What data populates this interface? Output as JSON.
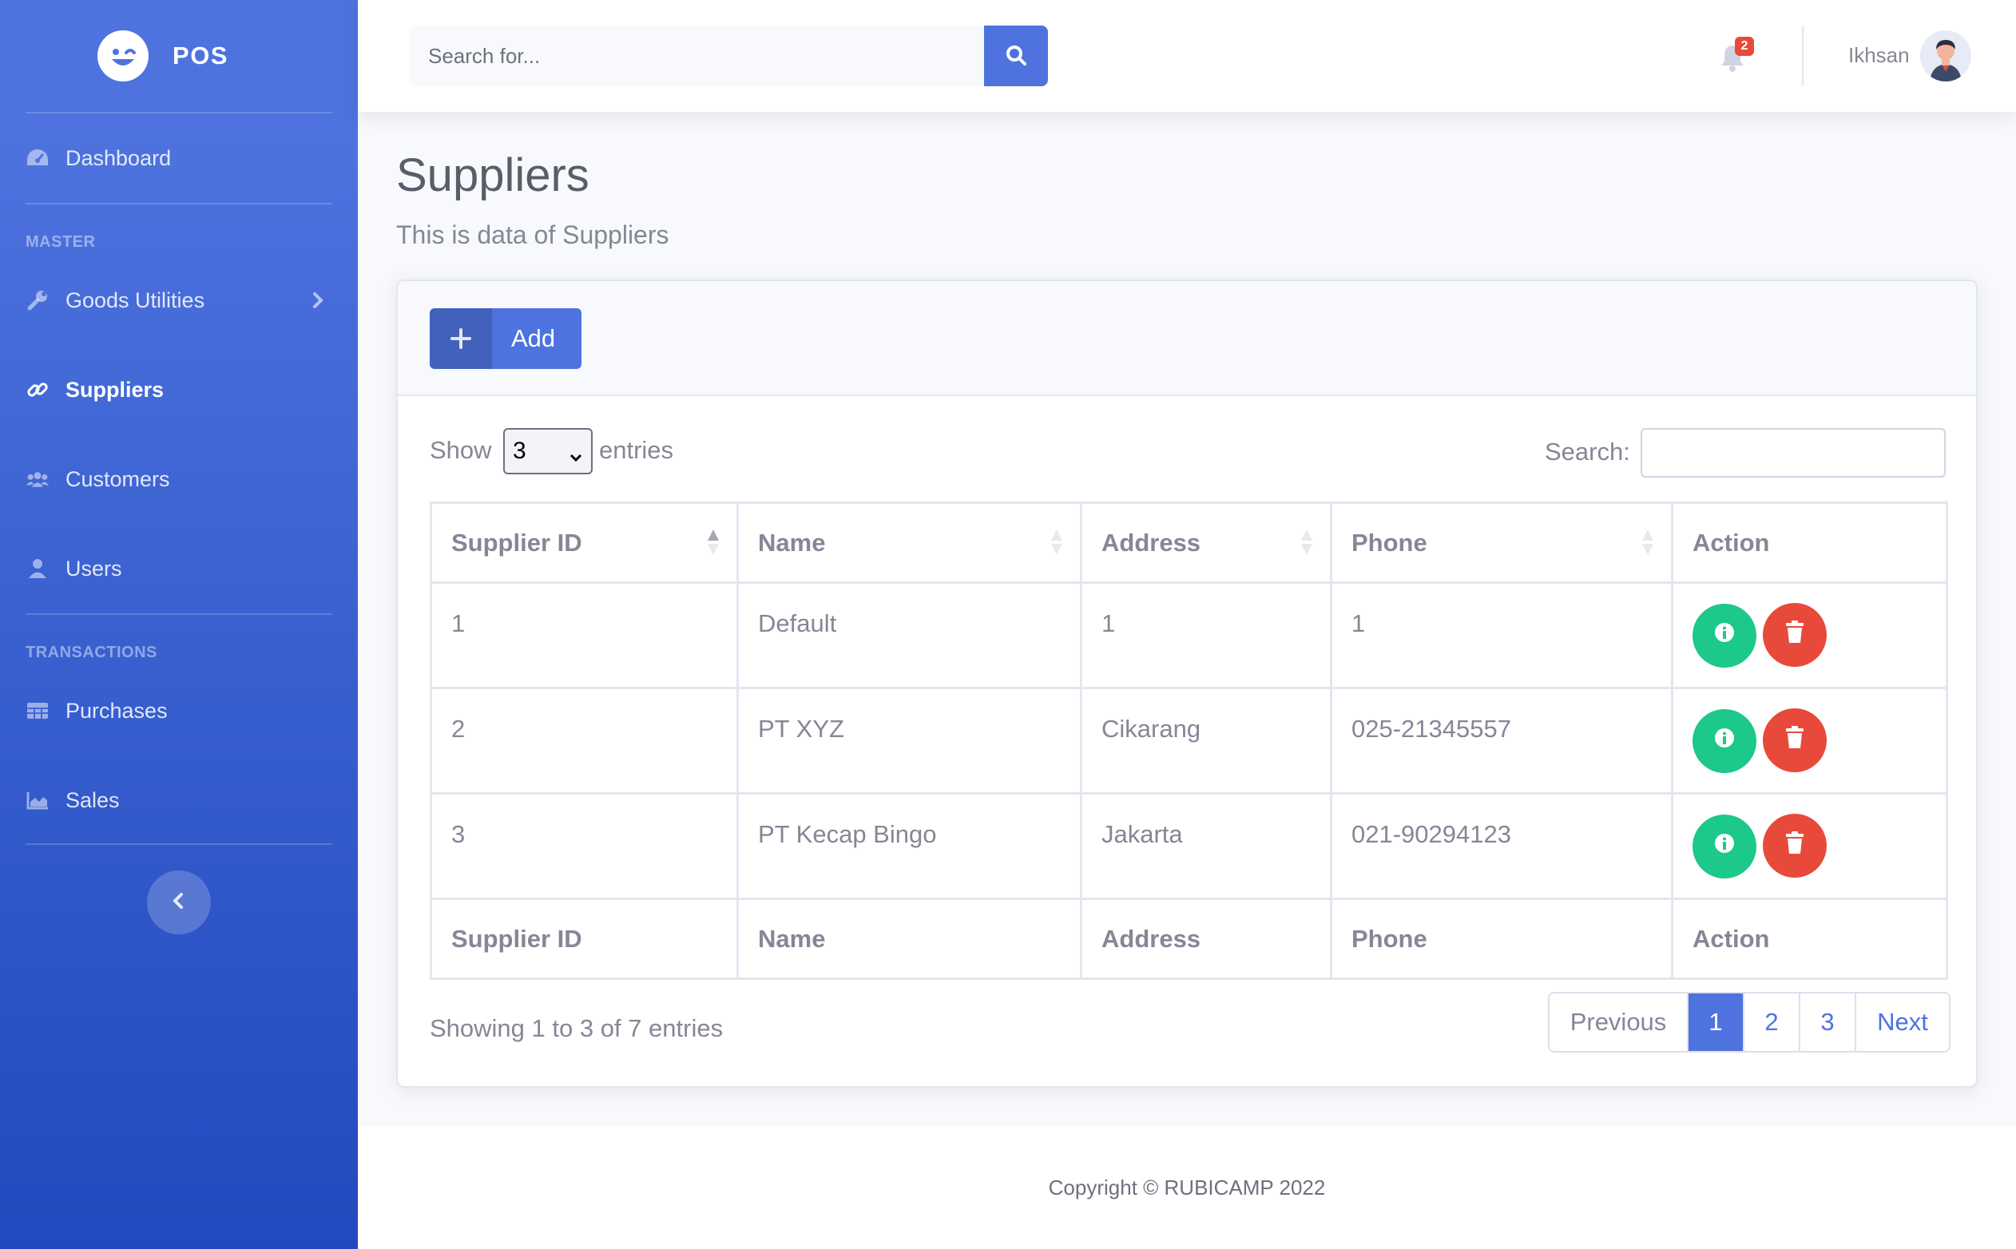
{
  "brand": {
    "name": "POS"
  },
  "sidebar": {
    "dashboard": {
      "label": "Dashboard"
    },
    "heading_master": "MASTER",
    "items_master": [
      {
        "label": "Goods Utilities"
      },
      {
        "label": "Suppliers"
      },
      {
        "label": "Customers"
      },
      {
        "label": "Users"
      }
    ],
    "heading_transactions": "TRANSACTIONS",
    "items_transactions": [
      {
        "label": "Purchases"
      },
      {
        "label": "Sales"
      }
    ],
    "active_item": "Suppliers"
  },
  "topbar": {
    "search_placeholder": "Search for...",
    "notification_count": "2",
    "user_name": "Ikhsan"
  },
  "page": {
    "title": "Suppliers",
    "subtitle": "This is data of Suppliers"
  },
  "card": {
    "add_label": "Add",
    "show_label": "Show",
    "entries_label": "entries",
    "page_length": "3",
    "search_label": "Search:",
    "search_value": ""
  },
  "table": {
    "columns": [
      "Supplier ID",
      "Name",
      "Address",
      "Phone",
      "Action"
    ],
    "rows": [
      {
        "id": "1",
        "name": "Default",
        "address": "1",
        "phone": "1"
      },
      {
        "id": "2",
        "name": "PT XYZ",
        "address": "Cikarang",
        "phone": "025-21345557"
      },
      {
        "id": "3",
        "name": "PT Kecap Bingo",
        "address": "Jakarta",
        "phone": "021-90294123"
      }
    ]
  },
  "pagination": {
    "info": "Showing 1 to 3 of 7 entries",
    "previous": "Previous",
    "pages": [
      "1",
      "2",
      "3"
    ],
    "current": "1",
    "next": "Next"
  },
  "footer": {
    "text": "Copyright © RUBICAMP 2022"
  },
  "colors": {
    "primary": "#4e73df",
    "success": "#1cc88a",
    "danger": "#e74a3b",
    "text_muted": "#858796"
  },
  "icons": {
    "brand": "laugh-wink-icon",
    "dashboard": "tachometer-icon",
    "goods_utilities": "wrench-icon",
    "suppliers": "link-icon",
    "customers": "users-icon",
    "users": "user-icon",
    "purchases": "table-icon",
    "sales": "area-chart-icon",
    "search": "search-icon",
    "notification": "bell-icon",
    "add": "plus-icon",
    "detail": "info-icon",
    "delete": "trash-icon"
  }
}
